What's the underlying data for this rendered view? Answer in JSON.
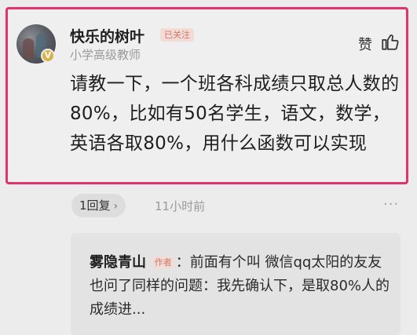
{
  "comment": {
    "username": "快乐的树叶",
    "followed_badge": "已关注",
    "user_title": "小学高级教师",
    "avatar_badge": "V",
    "like_label": "赞",
    "text": "请教一下，一个班各科成绩只取总人数的80%，比如有50名学生，语文，数学，英语各取80%，用什么函数可以实现",
    "reply_count_label": "1回复",
    "reply_chevron": "›",
    "time": "11小时前",
    "more": "···"
  },
  "reply": {
    "author": "雾隐青山",
    "author_tag": "作者",
    "text": "：前面有个叫 微信qq太阳的友友也问了同样的问题：我先确认下，是取80%人的成绩进..."
  },
  "colors": {
    "highlight_border": "#e0336f",
    "follow_badge_text": "#d2776a",
    "background": "#ececec"
  }
}
